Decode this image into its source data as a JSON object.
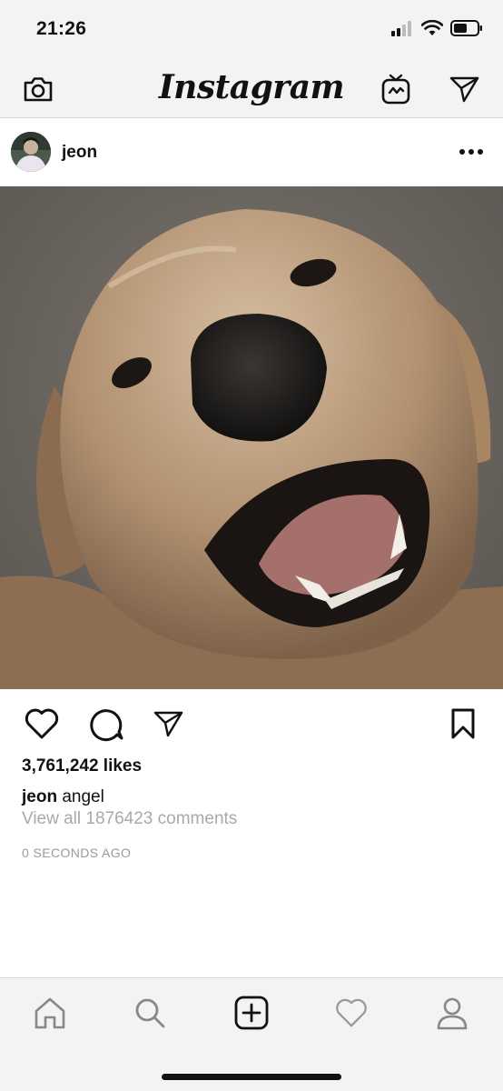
{
  "status_bar": {
    "time": "21:26"
  },
  "header": {
    "app_title": "Instagram",
    "camera_icon": "camera-icon",
    "igtv_icon": "igtv-icon",
    "direct_icon": "paper-plane-icon"
  },
  "post": {
    "username": "jeon",
    "likes": "3,761,242 likes",
    "caption_user": "jeon",
    "caption_text": "angel",
    "view_comments": "View all 1876423 comments",
    "timestamp": "0 SECONDS AGO"
  },
  "bottom_nav": {
    "tabs": [
      "home-icon",
      "search-icon",
      "add-post-icon",
      "activity-heart-icon",
      "profile-icon"
    ]
  }
}
